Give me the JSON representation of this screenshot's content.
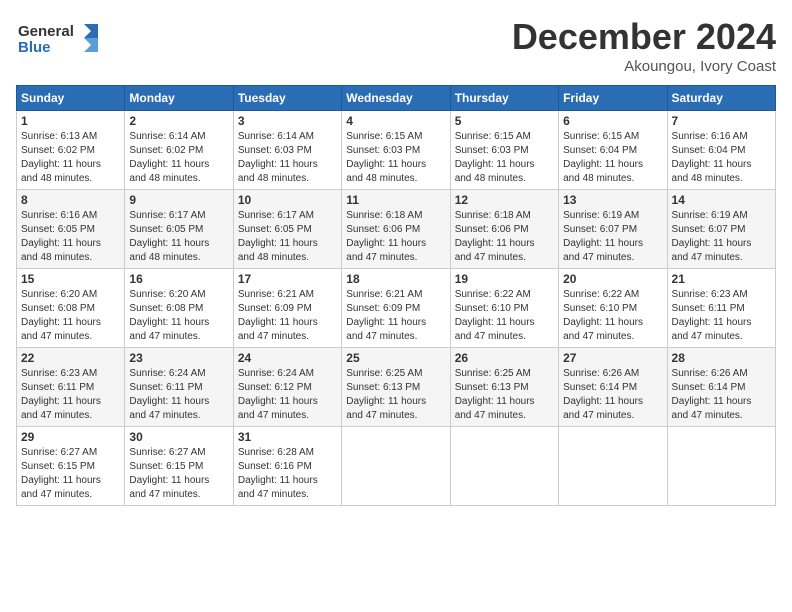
{
  "logo": {
    "line1": "General",
    "line2": "Blue"
  },
  "title": "December 2024",
  "location": "Akoungou, Ivory Coast",
  "days_of_week": [
    "Sunday",
    "Monday",
    "Tuesday",
    "Wednesday",
    "Thursday",
    "Friday",
    "Saturday"
  ],
  "weeks": [
    [
      {
        "day": "1",
        "info": "Sunrise: 6:13 AM\nSunset: 6:02 PM\nDaylight: 11 hours\nand 48 minutes."
      },
      {
        "day": "2",
        "info": "Sunrise: 6:14 AM\nSunset: 6:02 PM\nDaylight: 11 hours\nand 48 minutes."
      },
      {
        "day": "3",
        "info": "Sunrise: 6:14 AM\nSunset: 6:03 PM\nDaylight: 11 hours\nand 48 minutes."
      },
      {
        "day": "4",
        "info": "Sunrise: 6:15 AM\nSunset: 6:03 PM\nDaylight: 11 hours\nand 48 minutes."
      },
      {
        "day": "5",
        "info": "Sunrise: 6:15 AM\nSunset: 6:03 PM\nDaylight: 11 hours\nand 48 minutes."
      },
      {
        "day": "6",
        "info": "Sunrise: 6:15 AM\nSunset: 6:04 PM\nDaylight: 11 hours\nand 48 minutes."
      },
      {
        "day": "7",
        "info": "Sunrise: 6:16 AM\nSunset: 6:04 PM\nDaylight: 11 hours\nand 48 minutes."
      }
    ],
    [
      {
        "day": "8",
        "info": "Sunrise: 6:16 AM\nSunset: 6:05 PM\nDaylight: 11 hours\nand 48 minutes."
      },
      {
        "day": "9",
        "info": "Sunrise: 6:17 AM\nSunset: 6:05 PM\nDaylight: 11 hours\nand 48 minutes."
      },
      {
        "day": "10",
        "info": "Sunrise: 6:17 AM\nSunset: 6:05 PM\nDaylight: 11 hours\nand 48 minutes."
      },
      {
        "day": "11",
        "info": "Sunrise: 6:18 AM\nSunset: 6:06 PM\nDaylight: 11 hours\nand 47 minutes."
      },
      {
        "day": "12",
        "info": "Sunrise: 6:18 AM\nSunset: 6:06 PM\nDaylight: 11 hours\nand 47 minutes."
      },
      {
        "day": "13",
        "info": "Sunrise: 6:19 AM\nSunset: 6:07 PM\nDaylight: 11 hours\nand 47 minutes."
      },
      {
        "day": "14",
        "info": "Sunrise: 6:19 AM\nSunset: 6:07 PM\nDaylight: 11 hours\nand 47 minutes."
      }
    ],
    [
      {
        "day": "15",
        "info": "Sunrise: 6:20 AM\nSunset: 6:08 PM\nDaylight: 11 hours\nand 47 minutes."
      },
      {
        "day": "16",
        "info": "Sunrise: 6:20 AM\nSunset: 6:08 PM\nDaylight: 11 hours\nand 47 minutes."
      },
      {
        "day": "17",
        "info": "Sunrise: 6:21 AM\nSunset: 6:09 PM\nDaylight: 11 hours\nand 47 minutes."
      },
      {
        "day": "18",
        "info": "Sunrise: 6:21 AM\nSunset: 6:09 PM\nDaylight: 11 hours\nand 47 minutes."
      },
      {
        "day": "19",
        "info": "Sunrise: 6:22 AM\nSunset: 6:10 PM\nDaylight: 11 hours\nand 47 minutes."
      },
      {
        "day": "20",
        "info": "Sunrise: 6:22 AM\nSunset: 6:10 PM\nDaylight: 11 hours\nand 47 minutes."
      },
      {
        "day": "21",
        "info": "Sunrise: 6:23 AM\nSunset: 6:11 PM\nDaylight: 11 hours\nand 47 minutes."
      }
    ],
    [
      {
        "day": "22",
        "info": "Sunrise: 6:23 AM\nSunset: 6:11 PM\nDaylight: 11 hours\nand 47 minutes."
      },
      {
        "day": "23",
        "info": "Sunrise: 6:24 AM\nSunset: 6:11 PM\nDaylight: 11 hours\nand 47 minutes."
      },
      {
        "day": "24",
        "info": "Sunrise: 6:24 AM\nSunset: 6:12 PM\nDaylight: 11 hours\nand 47 minutes."
      },
      {
        "day": "25",
        "info": "Sunrise: 6:25 AM\nSunset: 6:13 PM\nDaylight: 11 hours\nand 47 minutes."
      },
      {
        "day": "26",
        "info": "Sunrise: 6:25 AM\nSunset: 6:13 PM\nDaylight: 11 hours\nand 47 minutes."
      },
      {
        "day": "27",
        "info": "Sunrise: 6:26 AM\nSunset: 6:14 PM\nDaylight: 11 hours\nand 47 minutes."
      },
      {
        "day": "28",
        "info": "Sunrise: 6:26 AM\nSunset: 6:14 PM\nDaylight: 11 hours\nand 47 minutes."
      }
    ],
    [
      {
        "day": "29",
        "info": "Sunrise: 6:27 AM\nSunset: 6:15 PM\nDaylight: 11 hours\nand 47 minutes."
      },
      {
        "day": "30",
        "info": "Sunrise: 6:27 AM\nSunset: 6:15 PM\nDaylight: 11 hours\nand 47 minutes."
      },
      {
        "day": "31",
        "info": "Sunrise: 6:28 AM\nSunset: 6:16 PM\nDaylight: 11 hours\nand 47 minutes."
      },
      {
        "day": "",
        "info": ""
      },
      {
        "day": "",
        "info": ""
      },
      {
        "day": "",
        "info": ""
      },
      {
        "day": "",
        "info": ""
      }
    ]
  ]
}
